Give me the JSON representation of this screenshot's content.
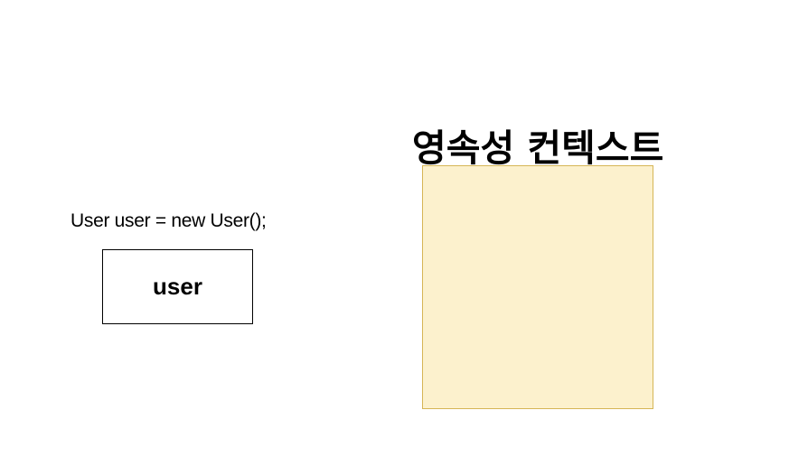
{
  "code": {
    "text": "User user = new User();"
  },
  "user_box": {
    "label": "user"
  },
  "persistence_context": {
    "title": "영속성 컨텍스트",
    "fill_color": "#fcf1cd",
    "border_color": "#d6b656"
  }
}
